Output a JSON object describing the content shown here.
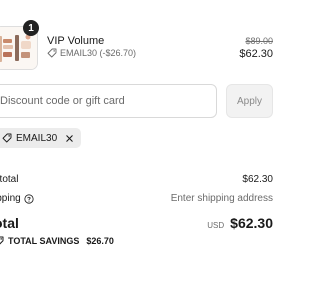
{
  "line_item": {
    "quantity": "1",
    "name": "VIP Volume",
    "discount_code_detail": "EMAIL30 (-$26.70)",
    "original_price": "$89.00",
    "price": "$62.30"
  },
  "discount": {
    "placeholder": "Discount code or gift card",
    "apply_label": "Apply",
    "applied_code": "EMAIL30"
  },
  "summary": {
    "subtotal_label": "btotal",
    "subtotal_value": "$62.30",
    "shipping_label": "ipping",
    "shipping_value": "Enter shipping address",
    "total_label": "otal",
    "total_currency": "USD",
    "total_value": "$62.30",
    "savings_label": "TOTAL SAVINGS",
    "savings_value": "$26.70"
  },
  "icons": {
    "tag": "tag-icon",
    "close": "close-icon",
    "help": "help-circle-icon"
  }
}
